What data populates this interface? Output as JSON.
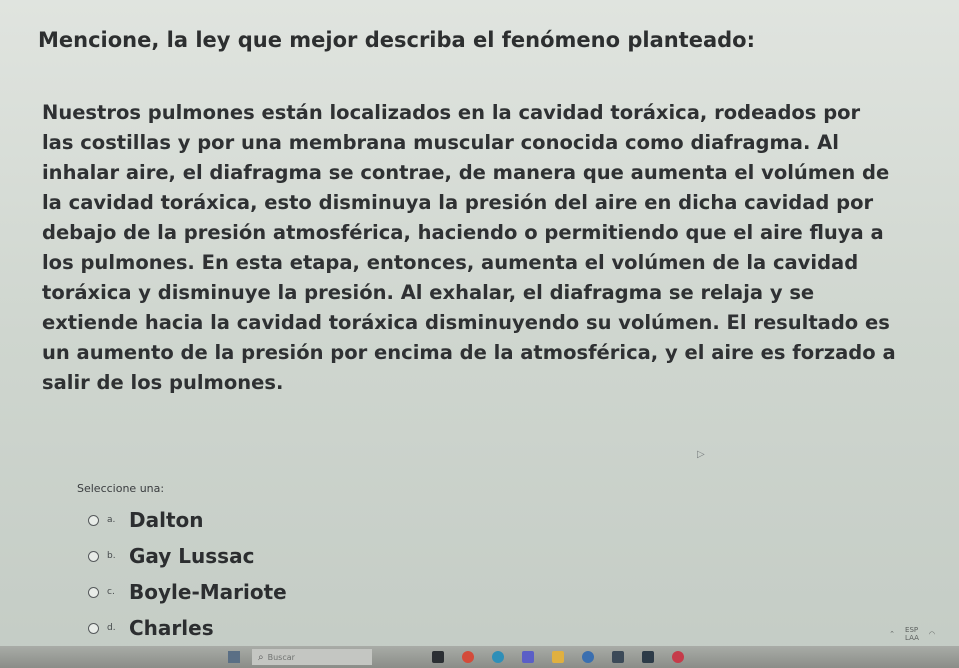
{
  "question": {
    "title": "Mencione, la ley que mejor describa el fenómeno planteado:",
    "passage_lines": [
      "Nuestros pulmones están localizados en la cavidad toráxica, rodeados por",
      "las costillas y por una membrana muscular conocida como diafragma.  Al",
      "inhalar aire, el diafragma se contrae, de manera que aumenta el volúmen de",
      "la cavidad toráxica, esto disminuya la presión del aire en dicha cavidad por",
      "debajo de la presión atmosférica, haciendo o permitiendo que el aire fluya a",
      "los pulmones.  En esta etapa, entonces, aumenta el volúmen de la cavidad",
      "toráxica y disminuye la presión.  Al exhalar, el diafragma se relaja y se",
      "extiende hacia la cavidad toráxica disminuyendo su volúmen.  El resultado es",
      "un aumento de la presión por encima de la atmosférica, y el aire es forzado a",
      "salir de los pulmones."
    ]
  },
  "answer": {
    "select_label": "Seleccione una:",
    "options": [
      {
        "letter": "a.",
        "text": "Dalton"
      },
      {
        "letter": "b.",
        "text": "Gay Lussac"
      },
      {
        "letter": "c.",
        "text": "Boyle-Mariote"
      },
      {
        "letter": "d.",
        "text": "Charles"
      }
    ]
  },
  "taskbar": {
    "search_placeholder": "Buscar",
    "tray_lang": "ESP",
    "tray_layout": "LAA",
    "icon_names": [
      "windows-start-icon",
      "search-icon",
      "file-explorer-icon",
      "chrome-icon",
      "edge-icon",
      "teams-icon",
      "folder-icon",
      "store-icon",
      "app-icon",
      "app-icon-2",
      "paint-icon"
    ],
    "colors": {
      "start": "#5a6f85",
      "chrome": "#d44b3a",
      "edge": "#2f8fb8",
      "teams": "#5b5fc7",
      "folder": "#e0b040",
      "store": "#3a6fb0",
      "app": "#3c4a58",
      "paint": "#c63b4a"
    }
  }
}
